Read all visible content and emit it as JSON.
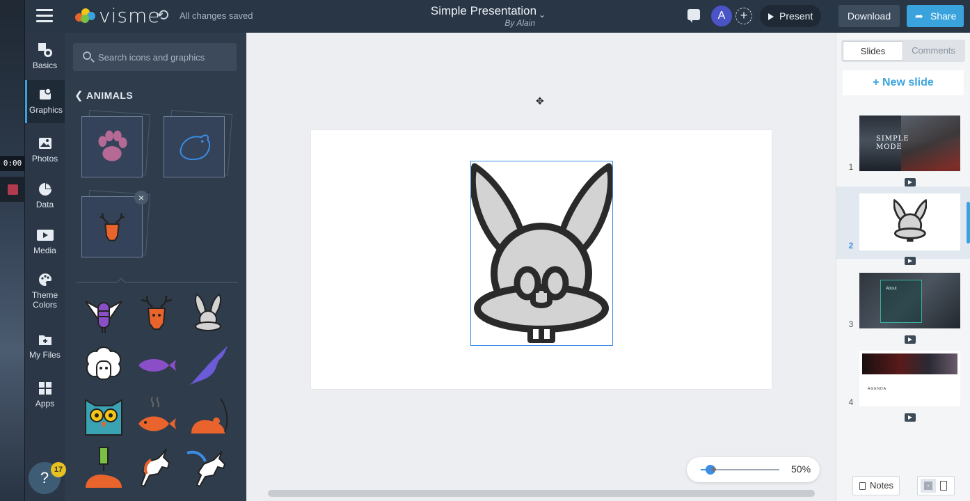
{
  "header": {
    "logo_text": "visme",
    "save_status": "All changes saved",
    "doc_title": "Simple Presentation",
    "doc_author": "By Alain",
    "avatar_initial": "A",
    "present_label": "Present",
    "download_label": "Download",
    "share_label": "Share"
  },
  "recorder": {
    "timer": "0:00"
  },
  "rail": {
    "items": [
      {
        "label": "Basics",
        "icon": "shapes-icon"
      },
      {
        "label": "Graphics",
        "icon": "graphics-icon"
      },
      {
        "label": "Photos",
        "icon": "photo-icon"
      },
      {
        "label": "Data",
        "icon": "pie-chart-icon"
      },
      {
        "label": "Media",
        "icon": "media-icon"
      },
      {
        "label": "Theme Colors",
        "icon": "palette-icon"
      },
      {
        "label": "My Files",
        "icon": "folder-icon"
      },
      {
        "label": "Apps",
        "icon": "apps-icon"
      }
    ],
    "active": "Graphics"
  },
  "help": {
    "label": "?",
    "badge_count": "17"
  },
  "panel": {
    "search_placeholder": "Search icons and graphics",
    "category_title": "ANIMALS",
    "collections": [
      {
        "icon": "paw-icon"
      },
      {
        "icon": "bird-icon"
      },
      {
        "icon": "deer-icon"
      }
    ],
    "grid_icons": [
      "bee-icon",
      "deer-head-icon",
      "donkey-icon",
      "sheep-icon",
      "fish-icon",
      "bat-icon",
      "owl-icon",
      "cooked-fish-icon",
      "mouse-icon",
      "mouse-trap-icon",
      "unicorn-icon",
      "pegasus-icon"
    ]
  },
  "canvas": {
    "zoom_label": "50%",
    "zoom_level": 0.12,
    "selected_graphic": "donkey-icon"
  },
  "right_panel": {
    "tabs": [
      "Slides",
      "Comments"
    ],
    "active_tab": "Slides",
    "new_slide_label": "New slide",
    "slides": [
      {
        "number": "1",
        "title_line1": "SIMPLE",
        "title_line2": "MODE"
      },
      {
        "number": "2",
        "title_line1": "",
        "title_line2": ""
      },
      {
        "number": "3",
        "title_line1": "About",
        "title_line2": ""
      },
      {
        "number": "4",
        "title_line1": "AGENDA",
        "title_line2": ""
      }
    ],
    "active_slide": "2",
    "notes_label": "Notes"
  },
  "colors": {
    "accent": "#3aa3dd",
    "topbar": "#293645",
    "panel": "#2f3c4c",
    "workspace": "#eceef1",
    "avatar": "#4b54c7",
    "icon_orange": "#e8642c",
    "icon_purple": "#8a4fc7"
  }
}
